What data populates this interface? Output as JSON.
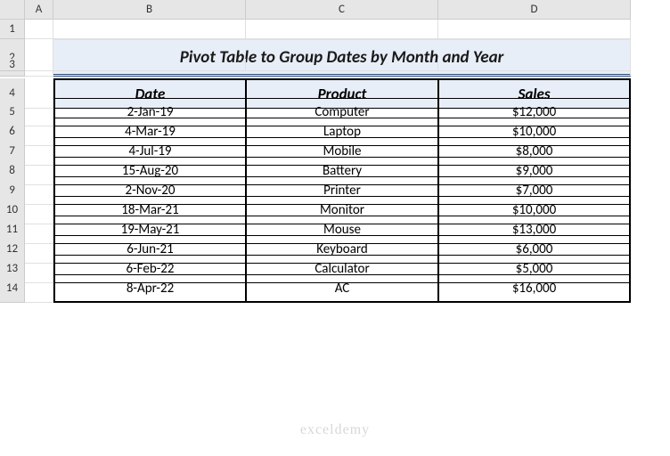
{
  "columns": [
    "A",
    "B",
    "C",
    "D"
  ],
  "rows": [
    "1",
    "2",
    "3",
    "4",
    "5",
    "6",
    "7",
    "8",
    "9",
    "10",
    "11",
    "12",
    "13",
    "14"
  ],
  "title": "Pivot Table to Group Dates by Month and Year",
  "headers": {
    "date": "Date",
    "product": "Product",
    "sales": "Sales"
  },
  "data": [
    {
      "date": "2-Jan-19",
      "product": "Computer",
      "sales": "$12,000"
    },
    {
      "date": "4-Mar-19",
      "product": "Laptop",
      "sales": "$10,000"
    },
    {
      "date": "4-Jul-19",
      "product": "Mobile",
      "sales": "$8,000"
    },
    {
      "date": "15-Aug-20",
      "product": "Battery",
      "sales": "$9,000"
    },
    {
      "date": "2-Nov-20",
      "product": "Printer",
      "sales": "$7,000"
    },
    {
      "date": "18-Mar-21",
      "product": "Monitor",
      "sales": "$10,000"
    },
    {
      "date": "19-May-21",
      "product": "Mouse",
      "sales": "$13,000"
    },
    {
      "date": "6-Jun-21",
      "product": "Keyboard",
      "sales": "$6,000"
    },
    {
      "date": "6-Feb-22",
      "product": "Calculator",
      "sales": "$5,000"
    },
    {
      "date": "8-Apr-22",
      "product": "AC",
      "sales": "$16,000"
    }
  ],
  "watermark": "exceldemy",
  "chart_data": {
    "type": "table",
    "title": "Pivot Table to Group Dates by Month and Year",
    "columns": [
      "Date",
      "Product",
      "Sales"
    ],
    "rows": [
      [
        "2-Jan-19",
        "Computer",
        12000
      ],
      [
        "4-Mar-19",
        "Laptop",
        10000
      ],
      [
        "4-Jul-19",
        "Mobile",
        8000
      ],
      [
        "15-Aug-20",
        "Battery",
        9000
      ],
      [
        "2-Nov-20",
        "Printer",
        7000
      ],
      [
        "18-Mar-21",
        "Monitor",
        10000
      ],
      [
        "19-May-21",
        "Mouse",
        13000
      ],
      [
        "6-Jun-21",
        "Keyboard",
        6000
      ],
      [
        "6-Feb-22",
        "Calculator",
        5000
      ],
      [
        "8-Apr-22",
        "AC",
        16000
      ]
    ]
  }
}
